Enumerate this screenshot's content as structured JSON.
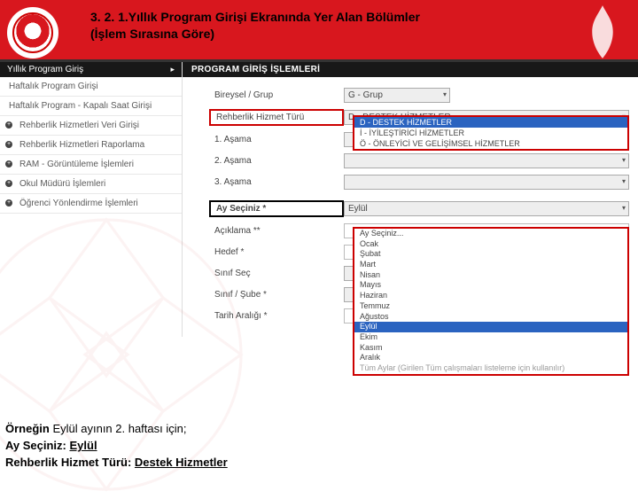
{
  "header": {
    "title_line1": "3. 2. 1.Yıllık  Program  Girişi  Ekranında  Yer  Alan  Bölümler",
    "title_line2": "(İşlem  Sırasına  Göre)"
  },
  "sidebar": {
    "top": "Yıllık Program Giriş",
    "items": [
      "Haftalık Program Girişi",
      "Haftalık Program - Kapalı Saat Girişi",
      "Rehberlik Hizmetleri Veri Girişi",
      "Rehberlik Hizmetleri Raporlama",
      "RAM - Görüntüleme İşlemleri",
      "Okul Müdürü İşlemleri",
      "Öğrenci Yönlendirme İşlemleri"
    ]
  },
  "main": {
    "header": "PROGRAM GİRİŞ İŞLEMLERİ",
    "rows": {
      "bireysel_grup": {
        "label": "Bireysel / Grup",
        "value": "G - Grup"
      },
      "rht": {
        "label": "Rehberlik Hizmet Türü",
        "value": "D - DESTEK HİZMETLER"
      },
      "asama1": "1. Aşama",
      "asama2": "2. Aşama",
      "asama3": "3. Aşama",
      "ay": {
        "label": "Ay Seçiniz *",
        "value": "Eylül"
      },
      "aciklama": "Açıklama **",
      "hedef": "Hedef *",
      "sinif_sec": "Sınıf Seç",
      "sinif_sube": "Sınıf / Şube *",
      "tarih": "Tarih Aralığı *"
    },
    "rht_dropdown": [
      {
        "text": "D - DESTEK HİZMETLER",
        "sel": true
      },
      {
        "text": "İ - İYİLEŞTİRİCİ HİZMETLER",
        "sel": false
      },
      {
        "text": "Ö - ÖNLEYİCİ VE GELİŞİMSEL HİZMETLER",
        "sel": false
      }
    ],
    "ay_dropdown": [
      {
        "text": "Ay Seçiniz...",
        "sel": false
      },
      {
        "text": "Ocak",
        "sel": false
      },
      {
        "text": "Şubat",
        "sel": false
      },
      {
        "text": "Mart",
        "sel": false
      },
      {
        "text": "Nisan",
        "sel": false
      },
      {
        "text": "Mayıs",
        "sel": false
      },
      {
        "text": "Haziran",
        "sel": false
      },
      {
        "text": "Temmuz",
        "sel": false
      },
      {
        "text": "Ağustos",
        "sel": false
      },
      {
        "text": "Eylül",
        "sel": true
      },
      {
        "text": "Ekim",
        "sel": false
      },
      {
        "text": "Kasım",
        "sel": false
      },
      {
        "text": "Aralık",
        "sel": false
      },
      {
        "text": "Tüm Aylar (Girilen Tüm çalışmaları listeleme için kullanılır)",
        "sel": false
      }
    ]
  },
  "footer": {
    "l1a": "Örneğin ",
    "l1b": "Eylül ayının 2. haftası için;",
    "l2a": "Ay Seçiniz: ",
    "l2b": "Eylül",
    "l3a": "Rehberlik Hizmet Türü: ",
    "l3b": "Destek Hizmetler"
  }
}
